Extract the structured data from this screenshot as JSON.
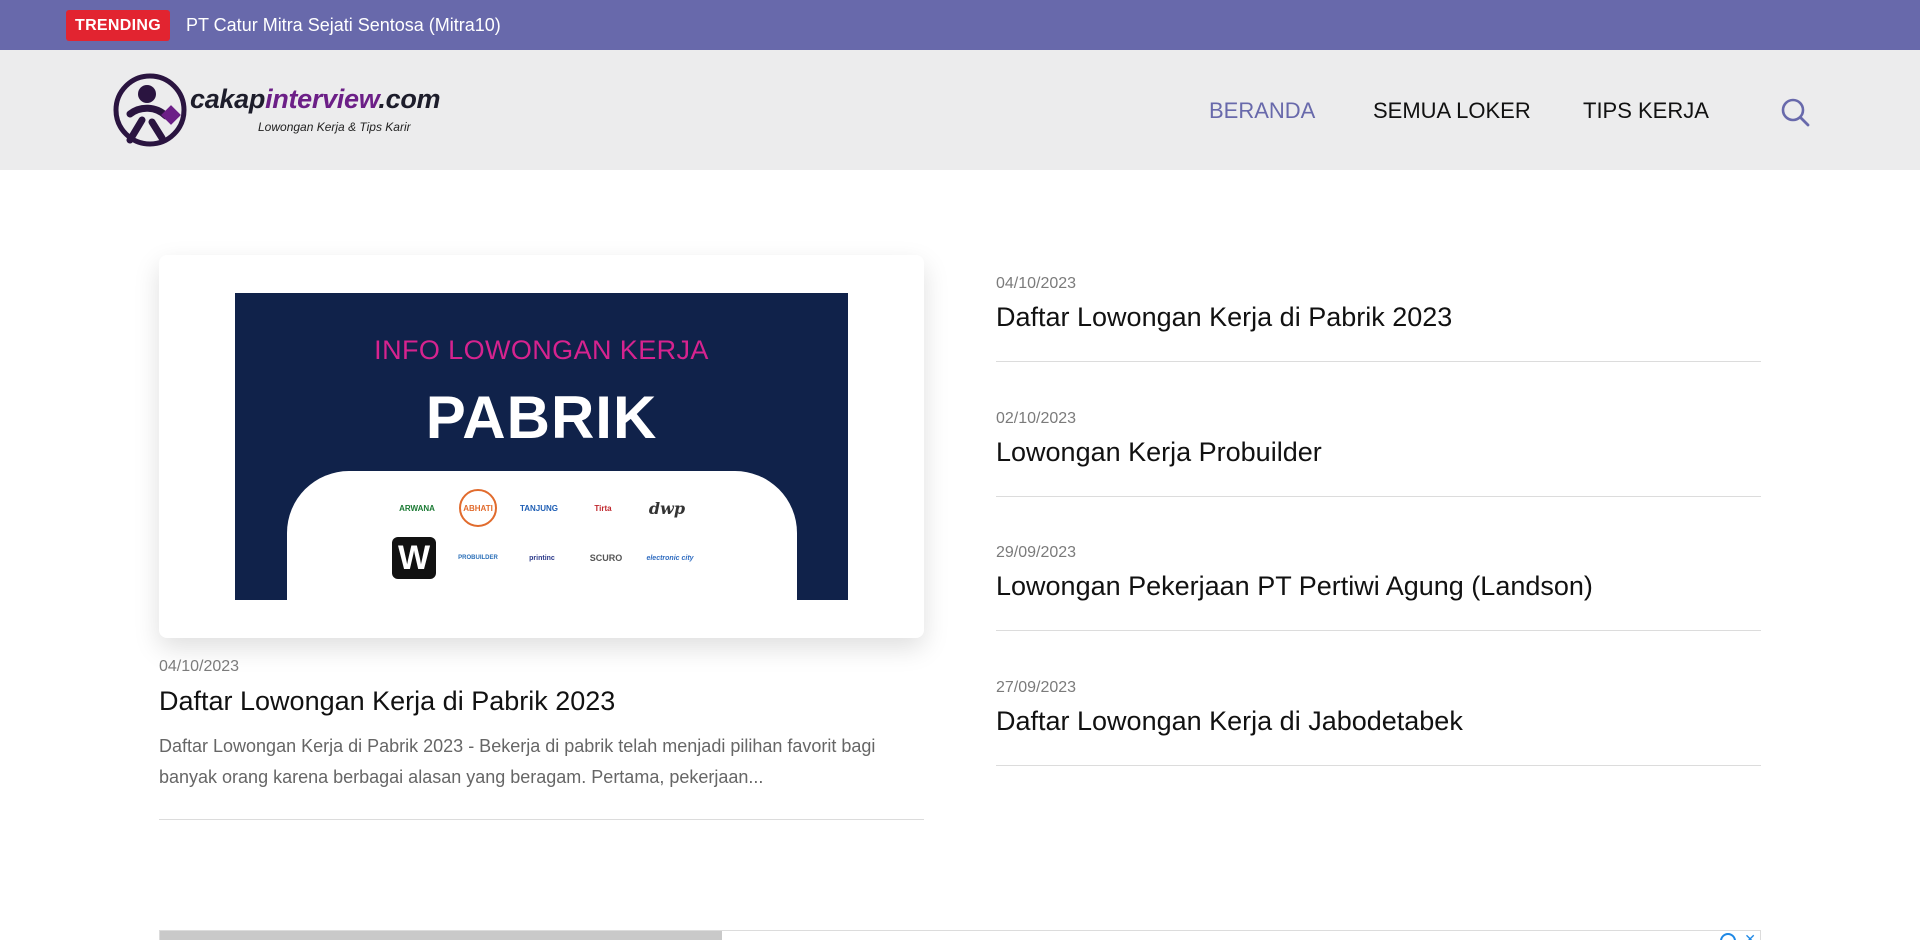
{
  "trending": {
    "badge": "TRENDING",
    "headline": "PT Catur Mitra Sejati Sentosa (Mitra10)"
  },
  "header": {
    "logo": {
      "name_part1": "cakap",
      "name_part2": "interview",
      "name_part3": ".com",
      "tagline": "Lowongan Kerja & Tips Karir"
    },
    "nav": [
      {
        "label": "BERANDA",
        "active": true
      },
      {
        "label": "SEMUA LOKER",
        "active": false
      },
      {
        "label": "TIPS KERJA",
        "active": false
      }
    ],
    "search_icon": "search-icon"
  },
  "featured": {
    "image": {
      "kicker": "INFO LOWONGAN KERJA",
      "title": "PABRIK",
      "company_logos_row1": [
        "ARWANA",
        "ABHATI",
        "TANJUNG",
        "Tirta",
        "dwp"
      ],
      "company_logos_row2": [
        "W",
        "PROBUILDER",
        "printinc",
        "SCURO",
        "electronic city"
      ]
    },
    "date": "04/10/2023",
    "title": "Daftar Lowongan Kerja di Pabrik 2023",
    "excerpt": "Daftar Lowongan Kerja di Pabrik 2023 - Bekerja di pabrik telah menjadi pilihan favorit bagi banyak orang karena berbagai alasan yang beragam. Pertama, pekerjaan..."
  },
  "posts": [
    {
      "date": "04/10/2023",
      "title": "Daftar Lowongan Kerja di Pabrik 2023"
    },
    {
      "date": "02/10/2023",
      "title": "Lowongan Kerja Probuilder"
    },
    {
      "date": "29/09/2023",
      "title": "Lowongan Pekerjaan PT Pertiwi Agung (Landson)"
    },
    {
      "date": "27/09/2023",
      "title": "Daftar Lowongan Kerja di Jabodetabek"
    }
  ],
  "colors": {
    "accent": "#6869ab",
    "trending_badge": "#e22430",
    "header_bg": "#ececed",
    "image_bg": "#10224a",
    "image_kicker": "#d6238f",
    "logo_purple": "#6c1f87"
  }
}
